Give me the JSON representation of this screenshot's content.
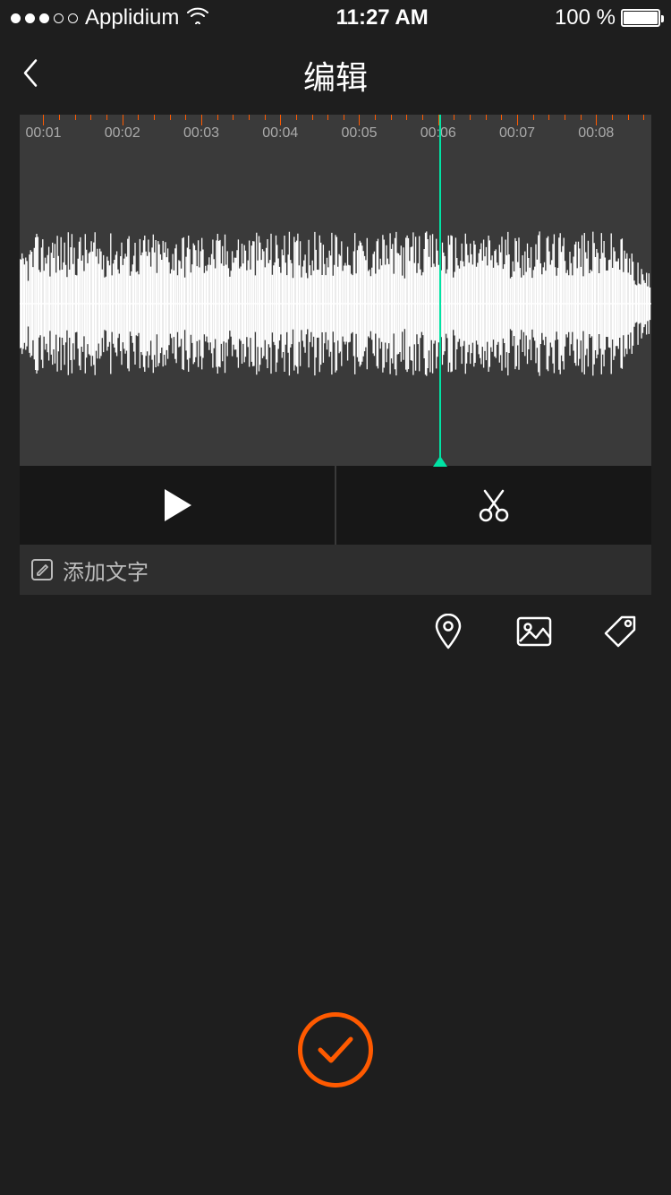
{
  "status": {
    "carrier": "Applidium",
    "time": "11:27 AM",
    "battery_text": "100 %"
  },
  "nav": {
    "title": "编辑"
  },
  "timeline": {
    "labels": [
      "00:01",
      "00:02",
      "00:03",
      "00:04",
      "00:05",
      "00:06",
      "00:07",
      "00:08"
    ],
    "playhead_position_pct": 66.5
  },
  "text_input": {
    "placeholder": "添加文字"
  },
  "icons": {
    "play": "play-icon",
    "cut": "scissors-icon",
    "edit": "pencil-icon",
    "location": "pin-icon",
    "image": "image-icon",
    "tag": "tag-icon",
    "confirm": "check-icon",
    "back": "chevron-left-icon",
    "wifi": "wifi-icon"
  },
  "colors": {
    "accent_orange": "#ff5a00",
    "accent_teal": "#00e3a4",
    "bg_dark": "#1e1e1e",
    "panel": "#3a3a3a"
  }
}
